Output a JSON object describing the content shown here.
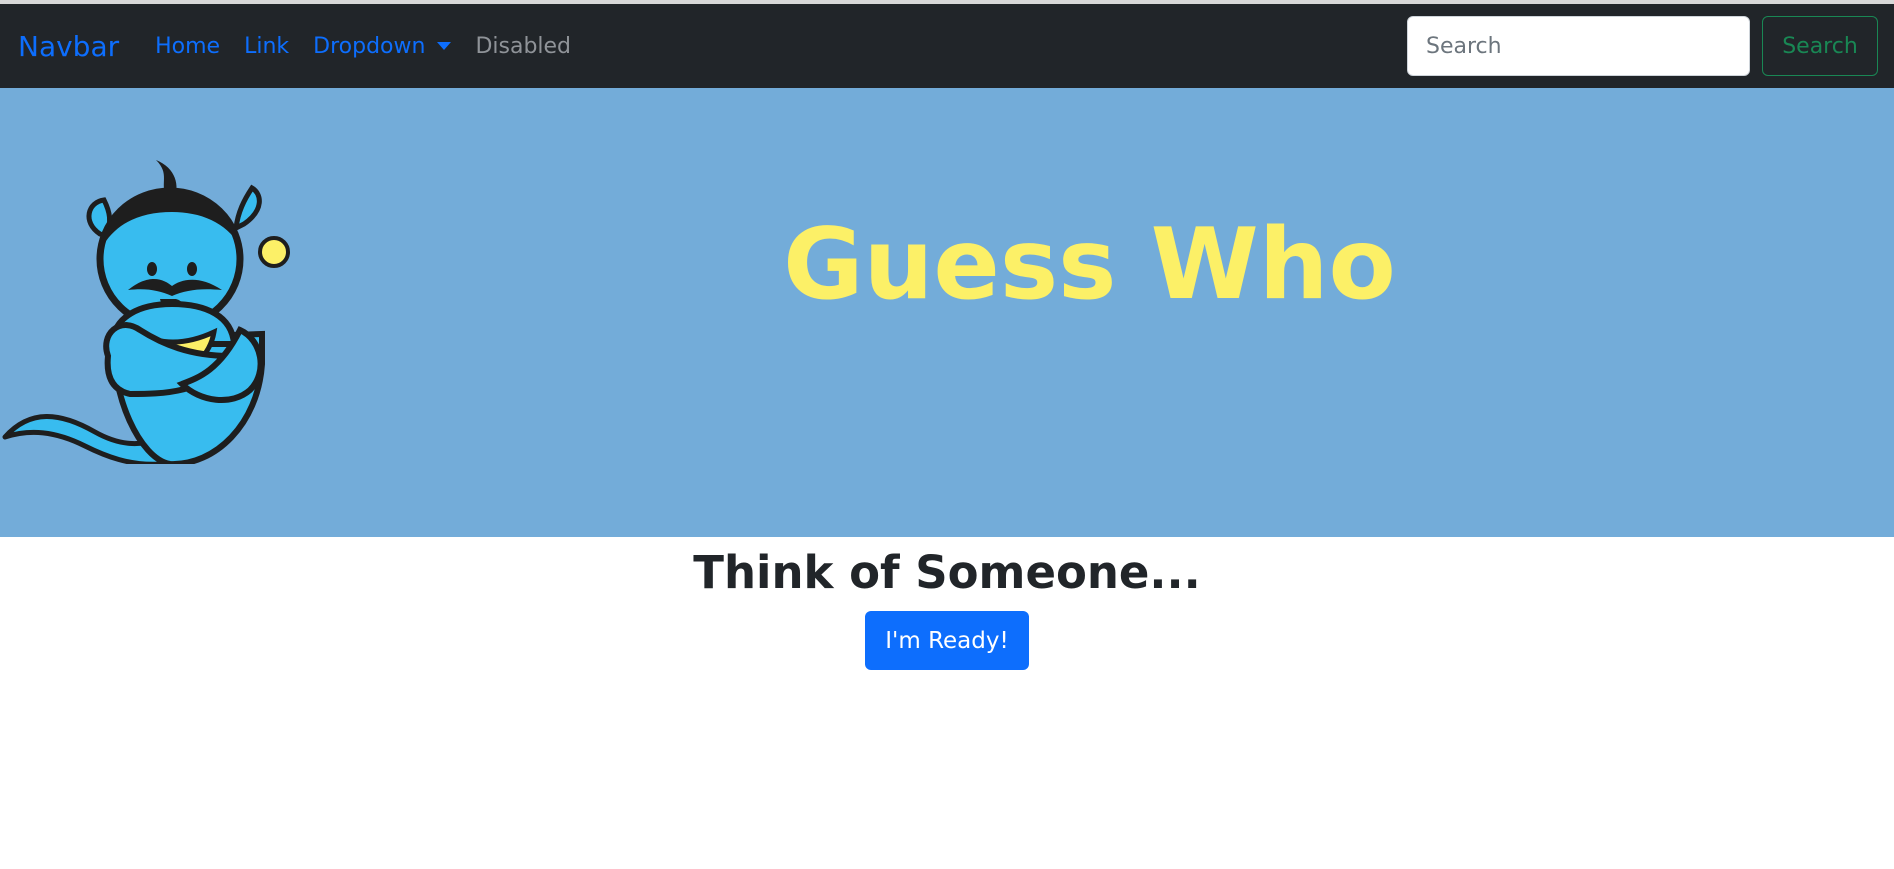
{
  "navbar": {
    "brand": "Navbar",
    "links": [
      {
        "label": "Home"
      },
      {
        "label": "Link"
      },
      {
        "label": "Dropdown"
      },
      {
        "label": "Disabled"
      }
    ],
    "search": {
      "placeholder": "Search",
      "value": "",
      "button_label": "Search"
    }
  },
  "hero": {
    "title": "Guess Who",
    "mascot_icon": "genie-icon"
  },
  "main": {
    "heading": "Think of Someone...",
    "button_label": "I'm Ready!"
  },
  "colors": {
    "navbar_bg": "#212529",
    "link": "#0d6efd",
    "hero_bg": "#73acd9",
    "hero_title": "#fcf067",
    "primary_button": "#0d6efd",
    "search_button": "#198754"
  }
}
